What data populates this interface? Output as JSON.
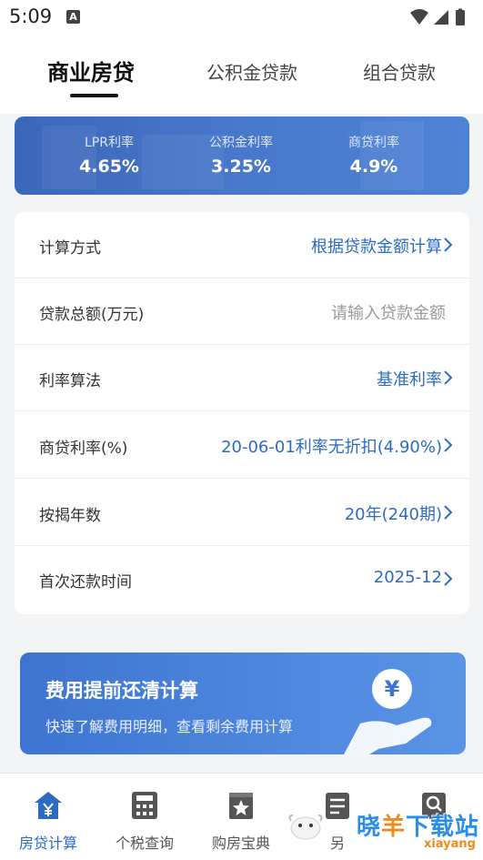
{
  "status_bar": {
    "time": "5:09",
    "notification_icon": "A"
  },
  "tabs": [
    {
      "label": "商业房贷",
      "active": true
    },
    {
      "label": "公积金贷款",
      "active": false
    },
    {
      "label": "组合贷款",
      "active": false
    }
  ],
  "rates": [
    {
      "label": "LPR利率",
      "value": "4.65%"
    },
    {
      "label": "公积金利率",
      "value": "3.25%"
    },
    {
      "label": "商贷利率",
      "value": "4.9%"
    }
  ],
  "form": {
    "calc_method": {
      "label": "计算方式",
      "value": "根据贷款金额计算"
    },
    "loan_amount": {
      "label": "贷款总额(万元)",
      "placeholder": "请输入贷款金额"
    },
    "rate_method": {
      "label": "利率算法",
      "value": "基准利率"
    },
    "commercial_rate": {
      "label": "商贷利率(%)",
      "value": "20-06-01利率无折扣(4.90%)"
    },
    "years": {
      "label": "按揭年数",
      "value": "20年(240期)"
    },
    "first_payment": {
      "label": "首次还款时间",
      "value": "2025-12"
    }
  },
  "promo": {
    "title": "费用提前还清计算",
    "subtitle": "快速了解费用明细，查看剩余费用计算",
    "coin_symbol": "¥"
  },
  "bottom_nav": [
    {
      "label": "房贷计算",
      "icon": "house-yen-icon",
      "active": true
    },
    {
      "label": "个税查询",
      "icon": "calculator-icon",
      "active": false
    },
    {
      "label": "购房宝典",
      "icon": "book-star-icon",
      "active": false
    },
    {
      "label": "另",
      "icon": "checklist-icon",
      "active": false
    },
    {
      "label": "",
      "icon": "search-doc-icon",
      "active": false
    }
  ],
  "watermark": {
    "text_a": "晓",
    "text_b": "羊",
    "text_c": "下载站",
    "sub": "xiayang"
  },
  "colors": {
    "accent": "#2d6bc2",
    "banner": "#4878cc",
    "text": "#333333"
  }
}
